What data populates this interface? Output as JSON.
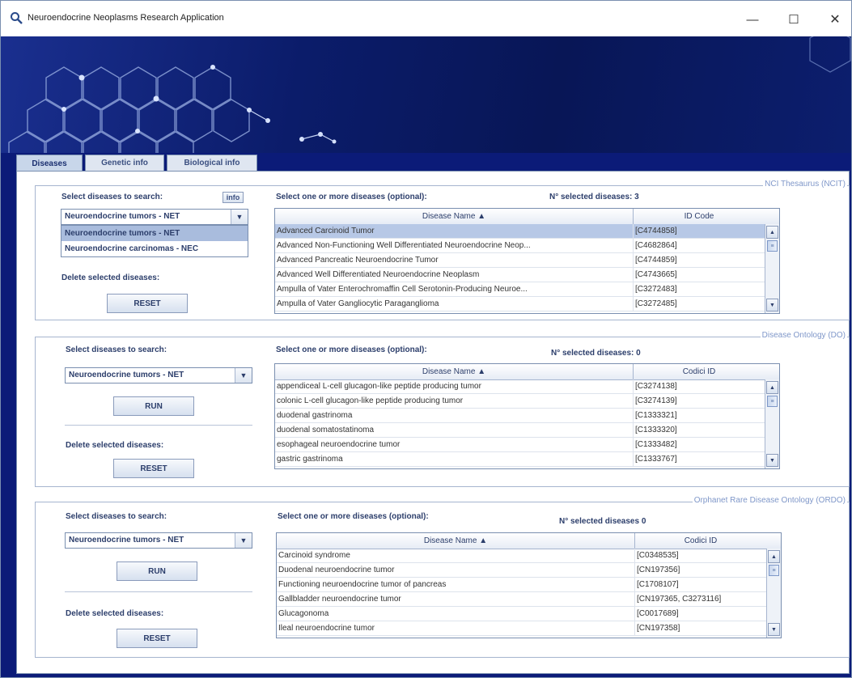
{
  "window": {
    "title": "Neuroendocrine Neoplasms Research Application",
    "minimize_icon": "—",
    "maximize_icon": "☐",
    "close_icon": "✕"
  },
  "tabs": [
    {
      "label": "Diseases",
      "active": true
    },
    {
      "label": "Genetic info",
      "active": false
    },
    {
      "label": "Biological info",
      "active": false
    }
  ],
  "groups": {
    "ncit": {
      "title": "NCI Thesaurus (NCIT)",
      "select_label": "Select diseases to search:",
      "info_label": "info",
      "combo_value": "Neuroendocrine tumors - NET",
      "dropdown_options": [
        "Neuroendocrine tumors - NET",
        "Neuroendocrine carcinomas - NEC"
      ],
      "delete_label": "Delete selected diseases:",
      "reset_label": "RESET",
      "table_label": "Select one or more diseases (optional):",
      "selected_count": "N° selected diseases: 3",
      "col_name": "Disease Name ▲",
      "col_code": "ID Code",
      "rows": [
        {
          "name": "Advanced Carcinoid Tumor",
          "code": "[C4744858]"
        },
        {
          "name": "Advanced Non-Functioning Well Differentiated Neuroendocrine Neop...",
          "code": "[C4682864]"
        },
        {
          "name": "Advanced Pancreatic Neuroendocrine Tumor",
          "code": "[C4744859]"
        },
        {
          "name": "Advanced Well Differentiated Neuroendocrine Neoplasm",
          "code": "[C4743665]"
        },
        {
          "name": "Ampulla of Vater Enterochromaffin Cell Serotonin-Producing Neuroe...",
          "code": "[C3272483]"
        },
        {
          "name": "Ampulla of Vater Gangliocytic Paraganglioma",
          "code": "[C3272485]"
        }
      ]
    },
    "doid": {
      "title": "Disease Ontology (DO)",
      "select_label": "Select diseases to search:",
      "combo_value": "Neuroendocrine tumors - NET",
      "run_label": "RUN",
      "delete_label": "Delete selected diseases:",
      "reset_label": "RESET",
      "table_label": "Select one or more diseases (optional):",
      "selected_count": "N° selected diseases: 0",
      "col_name": "Disease Name ▲",
      "col_code": "Codici ID",
      "rows": [
        {
          "name": "appendiceal L-cell glucagon-like peptide producing tumor",
          "code": "[C3274138]"
        },
        {
          "name": "colonic L-cell glucagon-like peptide producing tumor",
          "code": "[C3274139]"
        },
        {
          "name": "duodenal gastrinoma",
          "code": "[C1333321]"
        },
        {
          "name": "duodenal somatostatinoma",
          "code": "[C1333320]"
        },
        {
          "name": "esophageal neuroendocrine tumor",
          "code": "[C1333482]"
        },
        {
          "name": "gastric gastrinoma",
          "code": "[C1333767]"
        }
      ]
    },
    "ordo": {
      "title": "Orphanet Rare Disease Ontology (ORDO)",
      "select_label": "Select diseases to search:",
      "combo_value": "Neuroendocrine tumors - NET",
      "run_label": "RUN",
      "delete_label": "Delete selected diseases:",
      "reset_label": "RESET",
      "table_label": "Select one or more diseases (optional):",
      "selected_count": "N° selected diseases 0",
      "col_name": "Disease Name ▲",
      "col_code": "Codici ID",
      "rows": [
        {
          "name": "Carcinoid syndrome",
          "code": "[C0348535]"
        },
        {
          "name": "Duodenal neuroendocrine tumor",
          "code": "[CN197356]"
        },
        {
          "name": "Functioning neuroendocrine tumor of pancreas",
          "code": "[C1708107]"
        },
        {
          "name": "Gallbladder neuroendocrine tumor",
          "code": "[CN197365, C3273116]"
        },
        {
          "name": "Glucagonoma",
          "code": "[C0017689]"
        },
        {
          "name": "Ileal neuroendocrine tumor",
          "code": "[CN197358]"
        }
      ]
    }
  },
  "icons": {
    "app": "search-icon",
    "dropdown": "chevron-down-icon",
    "scroll_up": "scroll-up-arrow-icon",
    "scroll_down": "scroll-down-arrow-icon",
    "scroll_thumb": "scroll-thumb-grip-icon"
  },
  "glyphs": {
    "combo_arrow": "▼",
    "scroll_up": "▲",
    "scroll_down": "▼",
    "thumb_grip": "≡"
  },
  "colors": {
    "banner": "#0b1c6a",
    "frame_blue": "#0b1b78",
    "label_text": "#2c3e6b",
    "group_title": "#7f97c9",
    "row_selected": "#b7c8e6"
  }
}
